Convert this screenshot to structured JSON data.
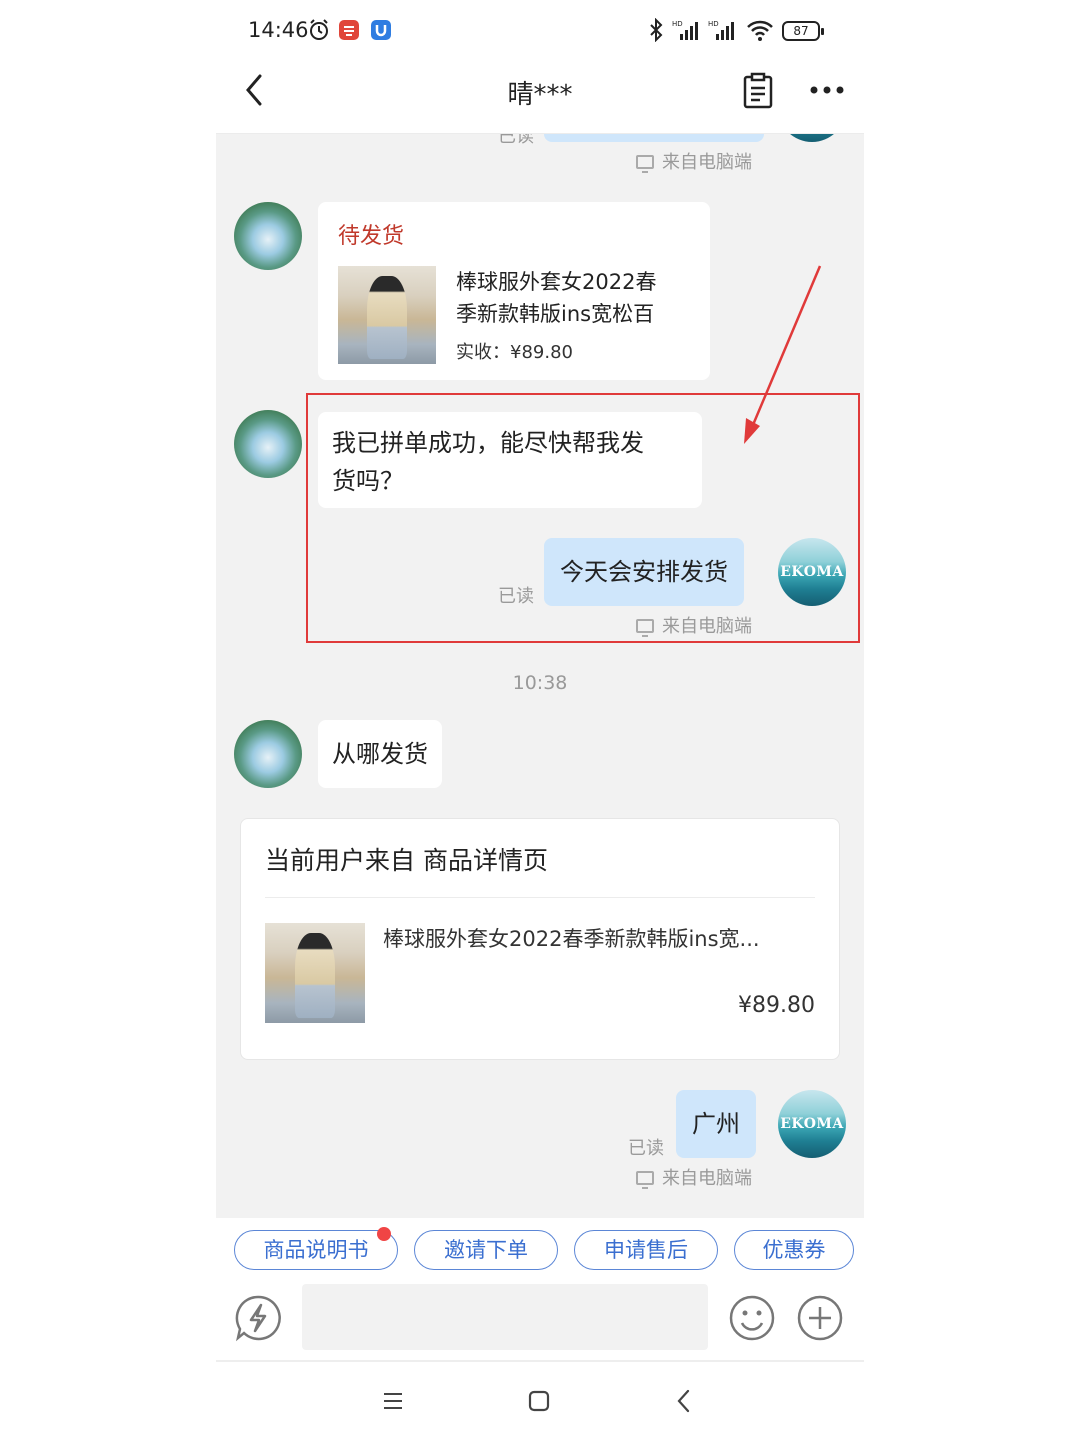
{
  "status_bar": {
    "time": "14:46",
    "battery": "87"
  },
  "header": {
    "title": "晴***"
  },
  "chat": {
    "top_partial": {
      "read": "已读",
      "source": "来自电脑端"
    },
    "order_card": {
      "status": "待发货",
      "title_line1": "棒球服外套女2022春",
      "title_line2": "季新款韩版ins宽松百",
      "price": "实收：¥89.80"
    },
    "msg_customer_1_line1": "我已拼单成功，能尽快帮我发",
    "msg_customer_1_line2": "货吗？",
    "msg_seller_1": "今天会安排发货",
    "msg_seller_1_read": "已读",
    "msg_seller_1_source": "来自电脑端",
    "timestamp": "10:38",
    "msg_customer_2": "从哪发货",
    "source_card": {
      "heading": "当前用户来自 商品详情页",
      "product_name": "棒球服外套女2022春季新款韩版ins宽...",
      "price": "¥89.80"
    },
    "msg_seller_2": "广州",
    "msg_seller_2_read": "已读",
    "msg_seller_2_source": "来自电脑端",
    "avatar_text": "EKOMA"
  },
  "quick_actions": [
    {
      "label": "商品说明书",
      "badge": true
    },
    {
      "label": "邀请下单"
    },
    {
      "label": "申请售后"
    },
    {
      "label": "优惠券"
    }
  ],
  "colors": {
    "accent_blue": "#3b6fd0",
    "order_status_red": "#c0392b",
    "highlight_red": "#e03a3a",
    "seller_bubble": "#cfe6fb"
  }
}
